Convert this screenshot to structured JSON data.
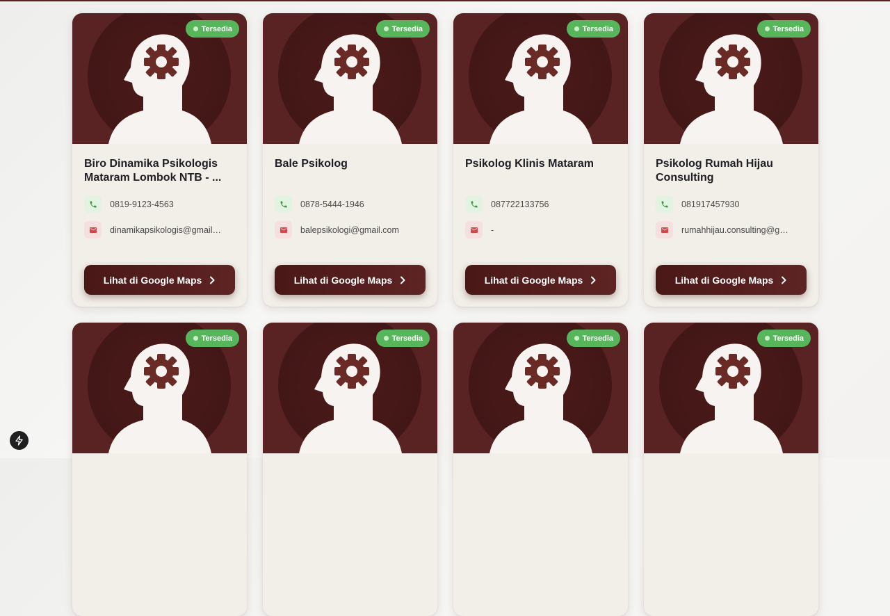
{
  "badge_label": "Tersedia",
  "button_label": "Lihat di Google Maps",
  "cards": [
    {
      "name": "Biro Dinamika Psikologis Mataram Lombok NTB - ...",
      "phone": "0819-9123-4563",
      "email": "dinamikapsikologis@gmail...."
    },
    {
      "name": "Bale Psikolog",
      "phone": "0878-5444-1946",
      "email": "balepsikologi@gmail.com"
    },
    {
      "name": "Psikolog Klinis Mataram",
      "phone": "087722133756",
      "email": "-"
    },
    {
      "name": "Psikolog Rumah Hijau Consulting",
      "phone": "081917457930",
      "email": "rumahhijau.consulting@gma..."
    },
    {
      "name": "",
      "phone": "",
      "email": ""
    },
    {
      "name": "",
      "phone": "",
      "email": ""
    },
    {
      "name": "",
      "phone": "",
      "email": ""
    },
    {
      "name": "",
      "phone": "",
      "email": ""
    }
  ],
  "icons": {
    "hero": "head-gear-icon",
    "phone": "phone-icon",
    "email": "mail-icon",
    "chevron": "chevron-right-icon",
    "fab": "lightning-icon"
  },
  "colors": {
    "primary": "#5a2323",
    "badge": "#57b65c",
    "card_bg": "#f1efe8"
  }
}
